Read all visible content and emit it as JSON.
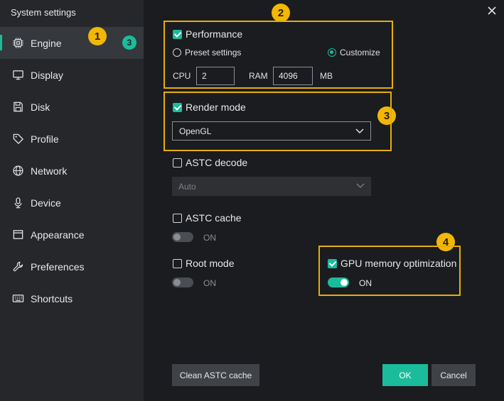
{
  "window": {
    "title": "System settings"
  },
  "sidebar": {
    "items": [
      {
        "label": "Engine",
        "icon": "chip-icon",
        "badge": "3"
      },
      {
        "label": "Display",
        "icon": "monitor-icon"
      },
      {
        "label": "Disk",
        "icon": "save-icon"
      },
      {
        "label": "Profile",
        "icon": "tag-icon"
      },
      {
        "label": "Network",
        "icon": "globe-icon"
      },
      {
        "label": "Device",
        "icon": "microphone-icon"
      },
      {
        "label": "Appearance",
        "icon": "window-icon"
      },
      {
        "label": "Preferences",
        "icon": "wrench-icon"
      },
      {
        "label": "Shortcuts",
        "icon": "keyboard-icon"
      }
    ]
  },
  "callouts": {
    "c1": "1",
    "c2": "2",
    "c3": "3",
    "c4": "4"
  },
  "performance": {
    "label": "Performance",
    "checked": true,
    "preset_label": "Preset settings",
    "customize_label": "Customize",
    "cpu_label": "CPU",
    "cpu_value": "2",
    "ram_label": "RAM",
    "ram_value": "4096",
    "ram_unit": "MB"
  },
  "render_mode": {
    "label": "Render mode",
    "checked": true,
    "value": "OpenGL"
  },
  "astc_decode": {
    "label": "ASTC decode",
    "checked": false,
    "value": "Auto"
  },
  "astc_cache": {
    "label": "ASTC cache",
    "checked": false,
    "toggle_text": "ON"
  },
  "root_mode": {
    "label": "Root mode",
    "checked": false,
    "toggle_text": "ON"
  },
  "gpu_memory": {
    "label": "GPU memory optimization",
    "checked": true,
    "toggle_text": "ON"
  },
  "buttons": {
    "clean": "Clean ASTC cache",
    "ok": "OK",
    "cancel": "Cancel"
  },
  "colors": {
    "accent": "#1abc9c",
    "callout": "#f2b705",
    "highlight": "#e6ae0b",
    "background": "#1b1c1f",
    "sidebar": "#25272b"
  }
}
